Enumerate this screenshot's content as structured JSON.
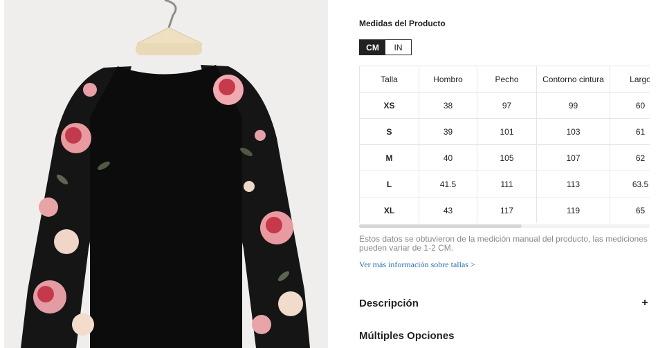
{
  "product_image": {
    "alt_icon": "floral-sweatshirt-image"
  },
  "measurements": {
    "title": "Medidas del Producto",
    "units": [
      {
        "label": "CM",
        "active": true
      },
      {
        "label": "IN",
        "active": false
      }
    ],
    "headers": [
      "Talla",
      "Hombro",
      "Pecho",
      "Contorno cintura",
      "Largo"
    ],
    "rows": [
      [
        "XS",
        "38",
        "97",
        "99",
        "60"
      ],
      [
        "S",
        "39",
        "101",
        "103",
        "61"
      ],
      [
        "M",
        "40",
        "105",
        "107",
        "62"
      ],
      [
        "L",
        "41.5",
        "111",
        "113",
        "63.5"
      ],
      [
        "XL",
        "43",
        "117",
        "119",
        "65"
      ]
    ],
    "note": "Estos datos se obtuvieron de la medición manual del producto, las mediciones pueden variar de 1-2 CM.",
    "more_link": "Ver más información sobre tallas >"
  },
  "sections": {
    "description": {
      "label": "Descripción",
      "icon": "+"
    },
    "options": {
      "label": "Múltiples Opciones"
    }
  },
  "colors": {
    "accent": "#222222",
    "link": "#2a6fb5",
    "note": "#8a8a8a"
  }
}
